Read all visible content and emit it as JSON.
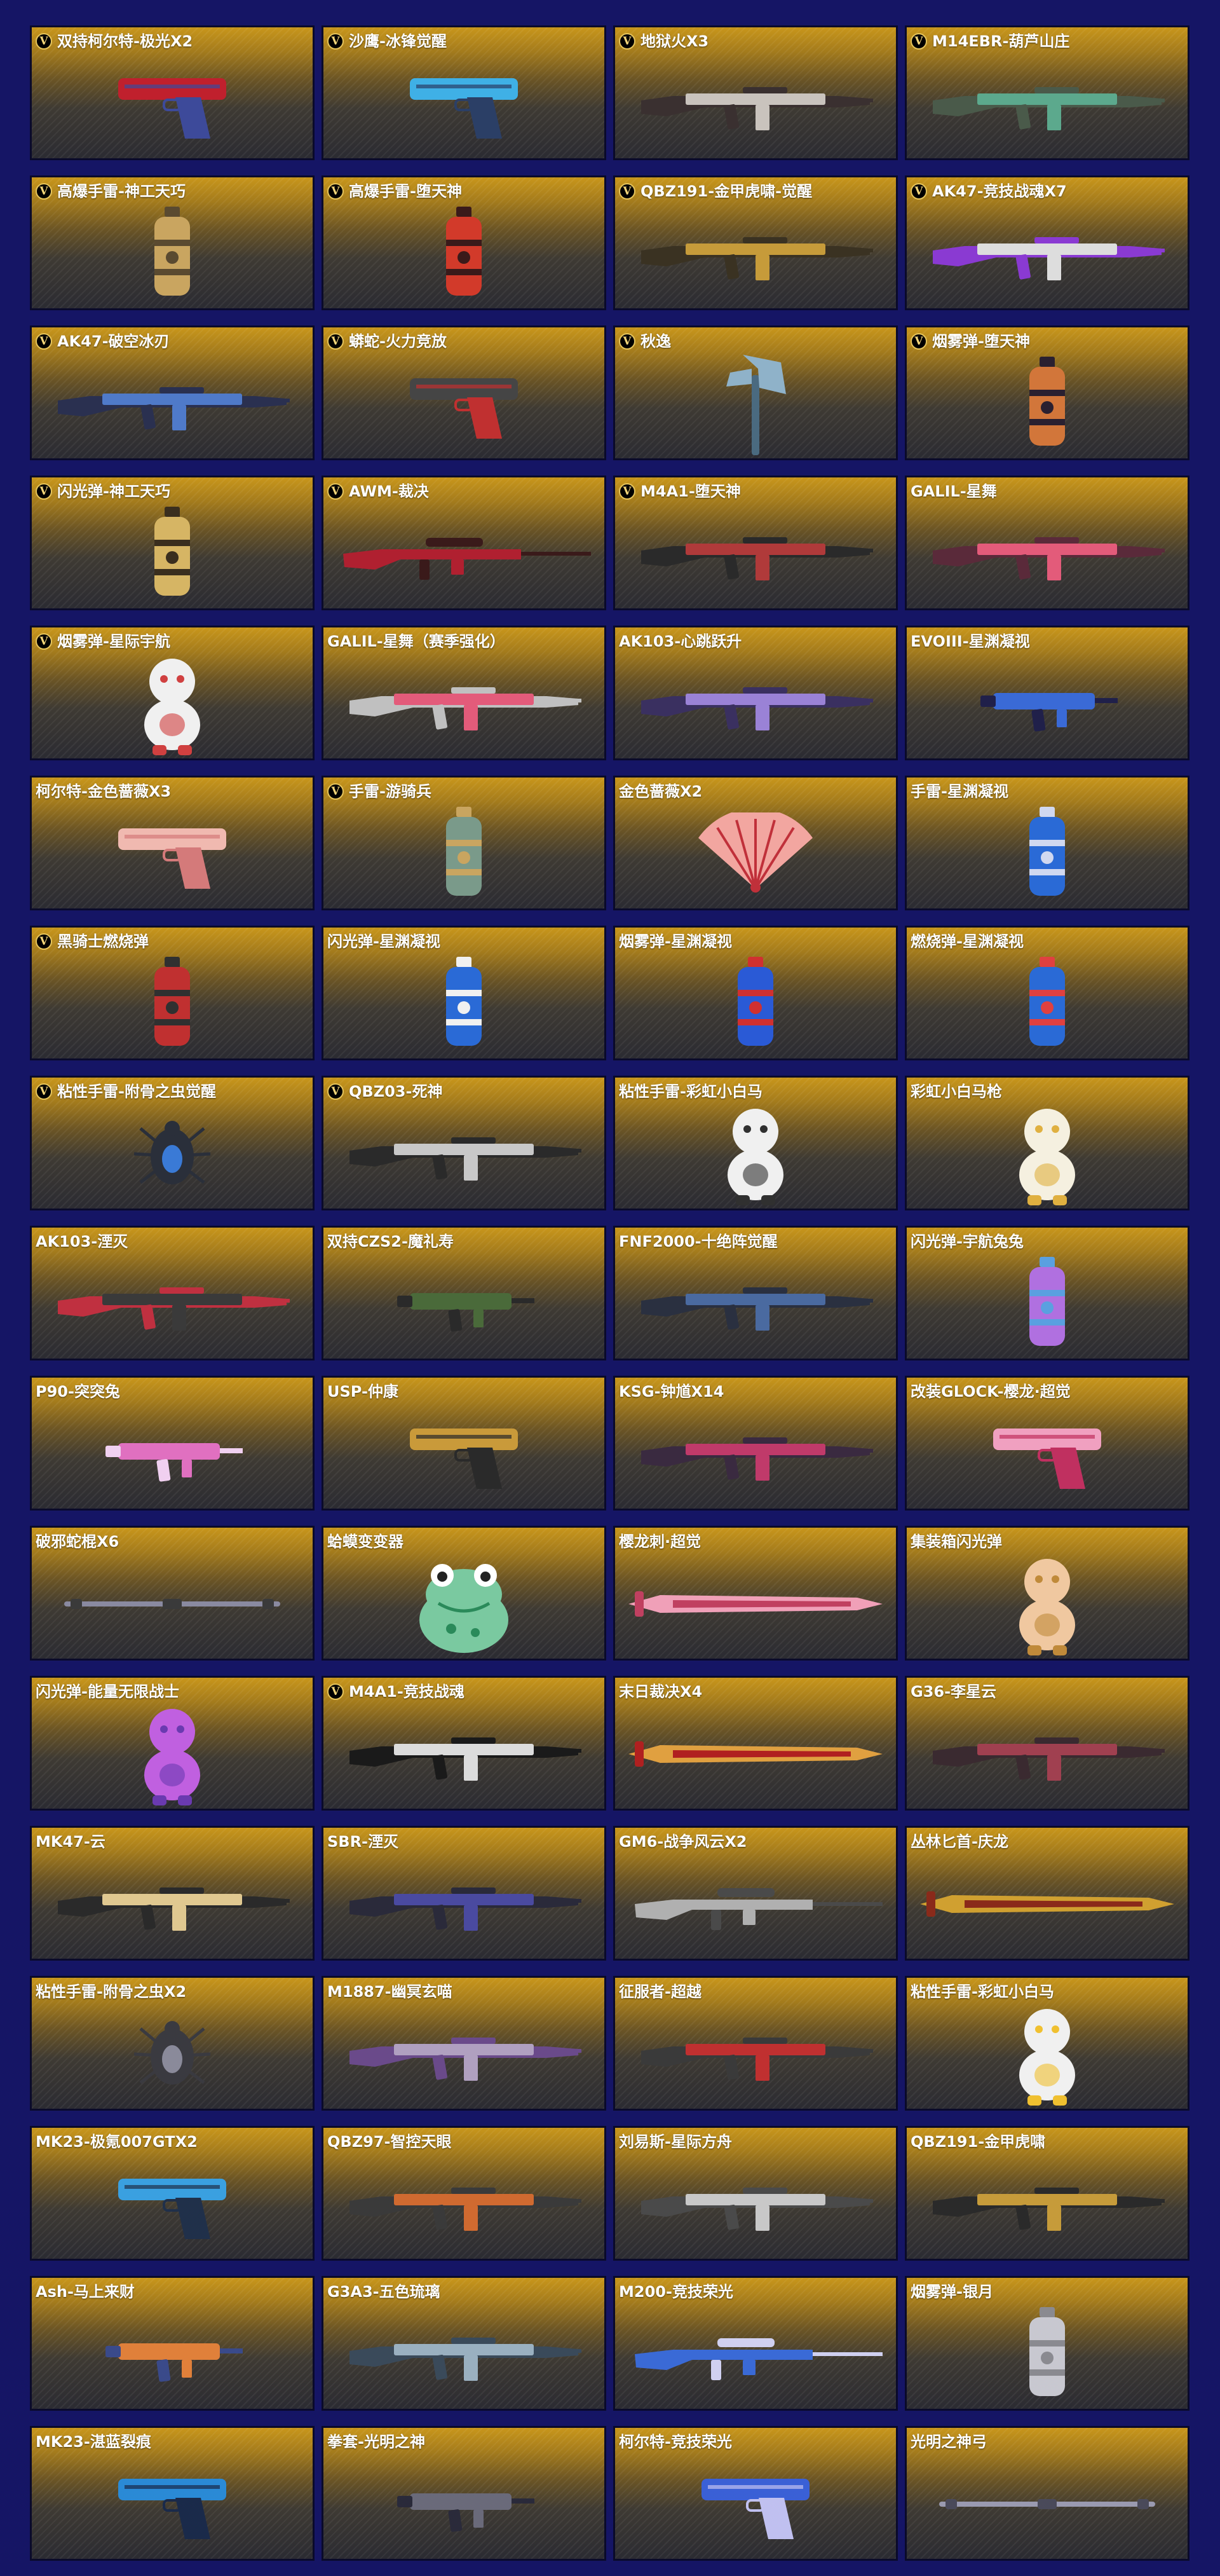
{
  "items": [
    {
      "name": "双持柯尔特-极光X2",
      "vip": true,
      "icon": "dual-pistols-icon",
      "kind": "pistol",
      "colors": [
        "#c0202d",
        "#3d4a9a"
      ]
    },
    {
      "name": "沙鹰-冰锋觉醒",
      "vip": true,
      "icon": "pistol-icon",
      "kind": "pistol",
      "colors": [
        "#3fb0e6",
        "#2b3f66"
      ]
    },
    {
      "name": "地狱火X3",
      "vip": true,
      "icon": "rifle-icon",
      "kind": "rifle",
      "colors": [
        "#c9c3bd",
        "#3a3030"
      ]
    },
    {
      "name": "M14EBR-葫芦山庄",
      "vip": true,
      "icon": "rifle-icon",
      "kind": "rifle",
      "colors": [
        "#5ca98d",
        "#4a5a4a"
      ]
    },
    {
      "name": "高爆手雷-神工天巧",
      "vip": true,
      "icon": "grenade-icon",
      "kind": "grenade",
      "colors": [
        "#c9a560",
        "#5a4a30"
      ]
    },
    {
      "name": "高爆手雷-堕天神",
      "vip": true,
      "icon": "grenade-icon",
      "kind": "grenade",
      "colors": [
        "#d23a2a",
        "#3a1a1a"
      ]
    },
    {
      "name": "QBZ191-金甲虎啸-觉醒",
      "vip": true,
      "icon": "rifle-icon",
      "kind": "rifle",
      "colors": [
        "#c69b3a",
        "#3a3222"
      ]
    },
    {
      "name": "AK47-竞技战魂X7",
      "vip": true,
      "icon": "rifle-icon",
      "kind": "rifle",
      "colors": [
        "#dddddd",
        "#8a3ad2"
      ]
    },
    {
      "name": "AK47-破空冰刃",
      "vip": true,
      "icon": "rifle-icon",
      "kind": "rifle",
      "colors": [
        "#4f7ac9",
        "#2a3050"
      ]
    },
    {
      "name": "蟒蛇-火力竞放",
      "vip": true,
      "icon": "revolver-icon",
      "kind": "pistol",
      "colors": [
        "#454545",
        "#c03030"
      ]
    },
    {
      "name": "秋逸",
      "vip": true,
      "icon": "axe-icon",
      "kind": "melee",
      "colors": [
        "#8fb2c9",
        "#4a6a80"
      ]
    },
    {
      "name": "烟雾弹-堕天神",
      "vip": true,
      "icon": "grenade-icon",
      "kind": "grenade",
      "colors": [
        "#d2763a",
        "#2a2030"
      ]
    },
    {
      "name": "闪光弹-神工天巧",
      "vip": true,
      "icon": "grenade-icon",
      "kind": "grenade",
      "colors": [
        "#d6b564",
        "#3a2e1e"
      ]
    },
    {
      "name": "AWM-裁决",
      "vip": true,
      "icon": "sniper-icon",
      "kind": "sniper",
      "colors": [
        "#b02030",
        "#3a1a1a"
      ]
    },
    {
      "name": "M4A1-堕天神",
      "vip": true,
      "icon": "rifle-icon",
      "kind": "rifle",
      "colors": [
        "#b03a3a",
        "#2a2a2a"
      ]
    },
    {
      "name": "GALIL-星舞",
      "vip": false,
      "icon": "rifle-icon",
      "kind": "rifle",
      "colors": [
        "#e35b7a",
        "#5a2a3a"
      ]
    },
    {
      "name": "烟雾弹-星际宇航",
      "vip": true,
      "icon": "astronaut-icon",
      "kind": "figure",
      "colors": [
        "#f0f0f0",
        "#d04040"
      ]
    },
    {
      "name": "GALIL-星舞（赛季强化）",
      "vip": false,
      "icon": "rifle-icon",
      "kind": "rifle",
      "colors": [
        "#e35b7a",
        "#c0c0c0"
      ]
    },
    {
      "name": "AK103-心跳跃升",
      "vip": false,
      "icon": "rifle-icon",
      "kind": "rifle",
      "colors": [
        "#9a82d6",
        "#3a3060"
      ]
    },
    {
      "name": "EVOIII-星渊凝视",
      "vip": false,
      "icon": "smg-icon",
      "kind": "smg",
      "colors": [
        "#3a6ad6",
        "#20204a"
      ]
    },
    {
      "name": "柯尔特-金色蔷薇X3",
      "vip": false,
      "icon": "pistol-icon",
      "kind": "pistol",
      "colors": [
        "#f0b9b0",
        "#d47a7a"
      ]
    },
    {
      "name": "手雷-游骑兵",
      "vip": true,
      "icon": "grenade-icon",
      "kind": "grenade",
      "colors": [
        "#7a9a8a",
        "#c9a560"
      ]
    },
    {
      "name": "金色蔷薇X2",
      "vip": false,
      "icon": "fan-icon",
      "kind": "fan",
      "colors": [
        "#f2a6a0",
        "#c0303a"
      ]
    },
    {
      "name": "手雷-星渊凝视",
      "vip": false,
      "icon": "grenade-icon",
      "kind": "grenade",
      "colors": [
        "#2a6ad6",
        "#d0d8f0"
      ]
    },
    {
      "name": "黑骑士燃烧弹",
      "vip": true,
      "icon": "grenade-icon",
      "kind": "grenade",
      "colors": [
        "#c03030",
        "#303030"
      ]
    },
    {
      "name": "闪光弹-星渊凝视",
      "vip": false,
      "icon": "grenade-icon",
      "kind": "grenade",
      "colors": [
        "#2a6ad6",
        "#f0f0f0"
      ]
    },
    {
      "name": "烟雾弹-星渊凝视",
      "vip": false,
      "icon": "grenade-icon",
      "kind": "grenade",
      "colors": [
        "#2a5ad6",
        "#d03030"
      ]
    },
    {
      "name": "燃烧弹-星渊凝视",
      "vip": false,
      "icon": "grenade-icon",
      "kind": "grenade",
      "colors": [
        "#2a6ad6",
        "#e04040"
      ]
    },
    {
      "name": "粘性手雷-附骨之虫觉醒",
      "vip": true,
      "icon": "bug-icon",
      "kind": "bug",
      "colors": [
        "#2a2f3a",
        "#3a7ad6"
      ]
    },
    {
      "name": "QBZ03-死神",
      "vip": true,
      "icon": "rifle-icon",
      "kind": "rifle",
      "colors": [
        "#c8c8c8",
        "#2a2a2a"
      ]
    },
    {
      "name": "粘性手雷-彩虹小白马",
      "vip": false,
      "icon": "horse-icon",
      "kind": "figure",
      "colors": [
        "#f0f0f0",
        "#303030"
      ]
    },
    {
      "name": "彩虹小白马枪",
      "vip": false,
      "icon": "horse-gun-icon",
      "kind": "figure",
      "colors": [
        "#f5f0e0",
        "#e0b040"
      ]
    },
    {
      "name": "AK103-湮灭",
      "vip": false,
      "icon": "rifle-icon",
      "kind": "rifle",
      "colors": [
        "#3a3a3a",
        "#c03040"
      ]
    },
    {
      "name": "双持CZS2-魔礼寿",
      "vip": false,
      "icon": "smg-icon",
      "kind": "smg",
      "colors": [
        "#4a6a3a",
        "#2a2a2a"
      ]
    },
    {
      "name": "FNF2000-十绝阵觉醒",
      "vip": false,
      "icon": "rifle-icon",
      "kind": "rifle",
      "colors": [
        "#4a6aa0",
        "#2a3040"
      ]
    },
    {
      "name": "闪光弹-宇航兔兔",
      "vip": false,
      "icon": "canister-icon",
      "kind": "grenade",
      "colors": [
        "#b070e0",
        "#5aa0e0"
      ]
    },
    {
      "name": "P90-突突兔",
      "vip": false,
      "icon": "smg-icon",
      "kind": "smg",
      "colors": [
        "#e070c0",
        "#f0d0f0"
      ]
    },
    {
      "name": "USP-仲康",
      "vip": false,
      "icon": "pistol-icon",
      "kind": "pistol",
      "colors": [
        "#c99a3a",
        "#2a2a2a"
      ]
    },
    {
      "name": "KSG-钟馗X14",
      "vip": false,
      "icon": "shotgun-icon",
      "kind": "rifle",
      "colors": [
        "#c03a6a",
        "#3a2a40"
      ]
    },
    {
      "name": "改装GLOCK-樱龙·超觉",
      "vip": false,
      "icon": "pistol-icon",
      "kind": "pistol",
      "colors": [
        "#f0a0c0",
        "#c03060"
      ]
    },
    {
      "name": "破邪蛇棍X6",
      "vip": false,
      "icon": "staff-icon",
      "kind": "staff",
      "colors": [
        "#8a8aa0",
        "#3a3a3a"
      ]
    },
    {
      "name": "蛤蟆变变器",
      "vip": false,
      "icon": "frog-icon",
      "kind": "frog",
      "colors": [
        "#7ac9a0",
        "#2a8a5a"
      ]
    },
    {
      "name": "樱龙刺·超觉",
      "vip": false,
      "icon": "dart-icon",
      "kind": "blade",
      "colors": [
        "#f0a0b8",
        "#c04060"
      ]
    },
    {
      "name": "集装箱闪光弹",
      "vip": false,
      "icon": "doll-icon",
      "kind": "figure",
      "colors": [
        "#f0c8a0",
        "#c08a3a"
      ]
    },
    {
      "name": "闪光弹-能量无限战士",
      "vip": false,
      "icon": "robot-icon",
      "kind": "figure",
      "colors": [
        "#c060e0",
        "#6a3ab0"
      ]
    },
    {
      "name": "M4A1-竞技战魂",
      "vip": true,
      "icon": "rifle-icon",
      "kind": "rifle",
      "colors": [
        "#dcdcdc",
        "#1a1a1a"
      ]
    },
    {
      "name": "末日裁决X4",
      "vip": false,
      "icon": "sword-icon",
      "kind": "blade",
      "colors": [
        "#e0a040",
        "#b02020"
      ]
    },
    {
      "name": "G36-李星云",
      "vip": false,
      "icon": "rifle-icon",
      "kind": "rifle",
      "colors": [
        "#a04050",
        "#3a2a30"
      ]
    },
    {
      "name": "MK47-云",
      "vip": false,
      "icon": "rifle-icon",
      "kind": "rifle",
      "colors": [
        "#e0c890",
        "#2a2a2a"
      ]
    },
    {
      "name": "SBR-湮灭",
      "vip": false,
      "icon": "rifle-icon",
      "kind": "rifle",
      "colors": [
        "#4a4aa0",
        "#2a2a3a"
      ]
    },
    {
      "name": "GM6-战争风云X2",
      "vip": false,
      "icon": "sniper-icon",
      "kind": "sniper",
      "colors": [
        "#b0b0b0",
        "#4a4a4a"
      ]
    },
    {
      "name": "丛林匕首-庆龙",
      "vip": false,
      "icon": "dragon-blade-icon",
      "kind": "blade",
      "colors": [
        "#d0a030",
        "#8a2a1a"
      ]
    },
    {
      "name": "粘性手雷-附骨之虫X2",
      "vip": false,
      "icon": "bug-icon",
      "kind": "bug",
      "colors": [
        "#3a3a40",
        "#8a8a9a"
      ]
    },
    {
      "name": "M1887-幽冥玄喵",
      "vip": false,
      "icon": "shotgun-icon",
      "kind": "rifle",
      "colors": [
        "#b0a0c0",
        "#6a4a8a"
      ]
    },
    {
      "name": "征服者-超越",
      "vip": false,
      "icon": "rifle-icon",
      "kind": "rifle",
      "colors": [
        "#c03030",
        "#3a3a3a"
      ]
    },
    {
      "name": "粘性手雷-彩虹小白马",
      "vip": false,
      "icon": "horse-icon",
      "kind": "figure",
      "colors": [
        "#f0f0f0",
        "#f0c030"
      ]
    },
    {
      "name": "MK23-极氪007GTX2",
      "vip": false,
      "icon": "pistol-icon",
      "kind": "pistol",
      "colors": [
        "#3aa0e0",
        "#20304a"
      ]
    },
    {
      "name": "QBZ97-智控天眼",
      "vip": false,
      "icon": "rifle-icon",
      "kind": "rifle",
      "colors": [
        "#d06a30",
        "#3a3a3a"
      ]
    },
    {
      "name": "刘易斯-星际方舟",
      "vip": false,
      "icon": "lmg-icon",
      "kind": "rifle",
      "colors": [
        "#c8c8c8",
        "#4a4a4a"
      ]
    },
    {
      "name": "QBZ191-金甲虎啸",
      "vip": false,
      "icon": "rifle-icon",
      "kind": "rifle",
      "colors": [
        "#c69b3a",
        "#2a2a2a"
      ]
    },
    {
      "name": "Ash-马上来财",
      "vip": false,
      "icon": "smg-icon",
      "kind": "smg",
      "colors": [
        "#e0803a",
        "#3a4a8a"
      ]
    },
    {
      "name": "G3A3-五色琉璃",
      "vip": false,
      "icon": "rifle-icon",
      "kind": "rifle",
      "colors": [
        "#9ab0c0",
        "#3a4a5a"
      ]
    },
    {
      "name": "M200-竞技荣光",
      "vip": false,
      "icon": "sniper-icon",
      "kind": "sniper",
      "colors": [
        "#3a6ad6",
        "#d0d0f0"
      ]
    },
    {
      "name": "烟雾弹-银月",
      "vip": false,
      "icon": "canister-icon",
      "kind": "grenade",
      "colors": [
        "#c8c8d0",
        "#8a8a90"
      ]
    },
    {
      "name": "MK23-湛蓝裂痕",
      "vip": false,
      "icon": "pistol-icon",
      "kind": "pistol",
      "colors": [
        "#2a8ad6",
        "#1a2a4a"
      ]
    },
    {
      "name": "拳套-光明之神",
      "vip": false,
      "icon": "knuckle-icon",
      "kind": "smg",
      "colors": [
        "#6a6a7a",
        "#2a2a3a"
      ]
    },
    {
      "name": "柯尔特-竞技荣光",
      "vip": false,
      "icon": "pistol-icon",
      "kind": "pistol",
      "colors": [
        "#3a60d6",
        "#c0c0f0"
      ]
    },
    {
      "name": "光明之神弓",
      "vip": false,
      "icon": "bow-icon",
      "kind": "staff",
      "colors": [
        "#9a9ab0",
        "#4a4a5a"
      ]
    }
  ]
}
